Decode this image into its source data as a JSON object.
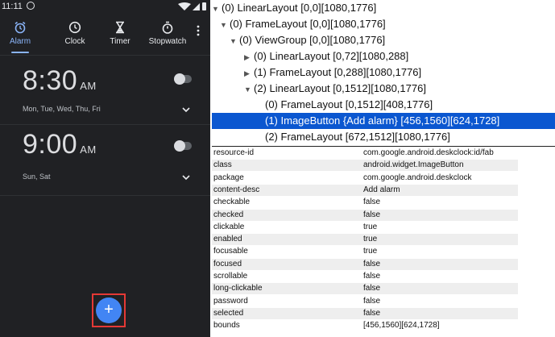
{
  "status_bar": {
    "time": "11:11"
  },
  "tabs": [
    {
      "label": "Alarm",
      "icon": "alarm-icon",
      "active": true
    },
    {
      "label": "Clock",
      "icon": "clock-icon"
    },
    {
      "label": "Timer",
      "icon": "timer-icon"
    },
    {
      "label": "Stopwatch",
      "icon": "stopwatch-icon"
    }
  ],
  "alarms": [
    {
      "time": "8:30",
      "ampm": "AM",
      "days": "Mon, Tue, Wed, Thu, Fri",
      "enabled": false
    },
    {
      "time": "9:00",
      "ampm": "AM",
      "days": "Sun, Sat",
      "enabled": false
    }
  ],
  "fab": {
    "label": "+",
    "content_desc": "Add alarm"
  },
  "colors": {
    "accent": "#8ab4f8",
    "fab": "#4285f4",
    "selection": "#0b57d0",
    "highlight": "#e53935"
  },
  "tree": [
    {
      "text": "(0) LinearLayout [0,0][1080,1776]",
      "arrow": "▼",
      "depth": 0
    },
    {
      "text": "(0) FrameLayout [0,0][1080,1776]",
      "arrow": "▼",
      "depth": 1
    },
    {
      "text": "(0) ViewGroup [0,0][1080,1776]",
      "arrow": "▼",
      "depth": 2
    },
    {
      "text": "(0) LinearLayout [0,72][1080,288]",
      "arrow": "▶",
      "depth": 3
    },
    {
      "text": "(1) FrameLayout [0,288][1080,1776]",
      "arrow": "▶",
      "depth": 3
    },
    {
      "text": "(2) LinearLayout [0,1512][1080,1776]",
      "arrow": "▼",
      "depth": 3
    },
    {
      "text": "(0) FrameLayout [0,1512][408,1776]",
      "arrow": "",
      "depth": 4
    },
    {
      "text": "(1) ImageButton {Add alarm} [456,1560][624,1728]",
      "arrow": "",
      "depth": 4,
      "selected": true
    },
    {
      "text": "(2) FrameLayout [672,1512][1080,1776]",
      "arrow": "",
      "depth": 4
    }
  ],
  "properties": [
    {
      "key": "resource-id",
      "value": "com.google.android.deskclock:id/fab"
    },
    {
      "key": "class",
      "value": "android.widget.ImageButton"
    },
    {
      "key": "package",
      "value": "com.google.android.deskclock"
    },
    {
      "key": "content-desc",
      "value": "Add alarm"
    },
    {
      "key": "checkable",
      "value": "false"
    },
    {
      "key": "checked",
      "value": "false"
    },
    {
      "key": "clickable",
      "value": "true"
    },
    {
      "key": "enabled",
      "value": "true"
    },
    {
      "key": "focusable",
      "value": "true"
    },
    {
      "key": "focused",
      "value": "false"
    },
    {
      "key": "scrollable",
      "value": "false"
    },
    {
      "key": "long-clickable",
      "value": "false"
    },
    {
      "key": "password",
      "value": "false"
    },
    {
      "key": "selected",
      "value": "false"
    },
    {
      "key": "bounds",
      "value": "[456,1560][624,1728]"
    }
  ]
}
